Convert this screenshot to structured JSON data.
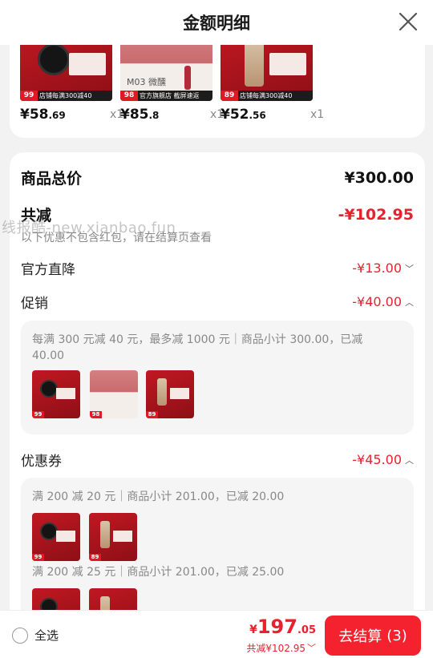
{
  "header": {
    "title": "金额明细"
  },
  "products": [
    {
      "thumb_price": "99",
      "strip": "店铺每满300减40",
      "price_int": "¥58",
      "price_dec": ".69",
      "qty": "x1"
    },
    {
      "thumb_price": "98",
      "strip": "官方旗舰店 截屏速返",
      "lip_label": "M03 微醺",
      "price_int": "¥85",
      "price_dec": ".8",
      "qty": "x1"
    },
    {
      "thumb_price": "89",
      "strip": "店铺每满300减40",
      "price_int": "¥52",
      "price_dec": ".56",
      "qty": "x1"
    }
  ],
  "summary": {
    "goods_total_label": "商品总价",
    "goods_total_value": "¥300.00",
    "discount_label": "共减",
    "discount_value": "-¥102.95",
    "hint": "以下优惠不包含红包，请在结算页查看",
    "watermark": "线报酷-new.xianbao.fun"
  },
  "official_drop": {
    "label": "官方直降",
    "value": "-¥13.00"
  },
  "promotion": {
    "label": "促销",
    "value": "-¥40.00",
    "detail": "每满 300 元减 40 元，最多减 1000 元｜商品小计 300.00，已减 40.00",
    "thumbs": [
      "99",
      "98",
      "89"
    ]
  },
  "coupon": {
    "label": "优惠券",
    "value": "-¥45.00",
    "rules": [
      {
        "text": "满 200 减 20 元｜商品小计 201.00，已减 20.00",
        "thumbs": [
          "99",
          "89"
        ]
      },
      {
        "text": "满 200 减 25 元｜商品小计 201.00，已减 25.00",
        "thumbs": [
          "99",
          "89"
        ]
      }
    ]
  },
  "bottom": {
    "select_all": "全选",
    "currency": "¥",
    "total_int": "197",
    "total_dec": ".05",
    "saved": "共减¥102.95",
    "checkout_label": "去结算",
    "checkout_count": "(3)"
  },
  "colors": {
    "accent": "#f4212e",
    "discount_red": "#e8212f"
  }
}
